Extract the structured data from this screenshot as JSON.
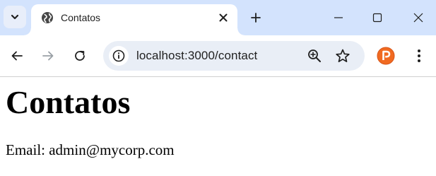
{
  "browser": {
    "tab": {
      "title": "Contatos",
      "favicon": "globe-icon"
    },
    "address_bar": {
      "url": "localhost:3000/contact"
    },
    "icons": {
      "tab_search": "chevron-down-icon",
      "tab_close": "close-icon",
      "new_tab": "plus-icon",
      "window_minimize": "minimize-icon",
      "window_maximize": "maximize-icon",
      "window_close": "close-icon",
      "back": "arrow-left-icon",
      "forward": "arrow-right-icon",
      "reload": "reload-icon",
      "site_info": "info-icon",
      "zoom": "zoom-in-icon",
      "bookmark": "star-icon",
      "extension": "extension-p-icon",
      "menu": "kebab-menu-icon"
    },
    "colors": {
      "tabstrip": "#d3e3fd",
      "omnibox": "#e9eef6",
      "extension_orange": "#f16a21"
    }
  },
  "page": {
    "heading": "Contatos",
    "email_line": "Email: admin@mycorp.com"
  }
}
